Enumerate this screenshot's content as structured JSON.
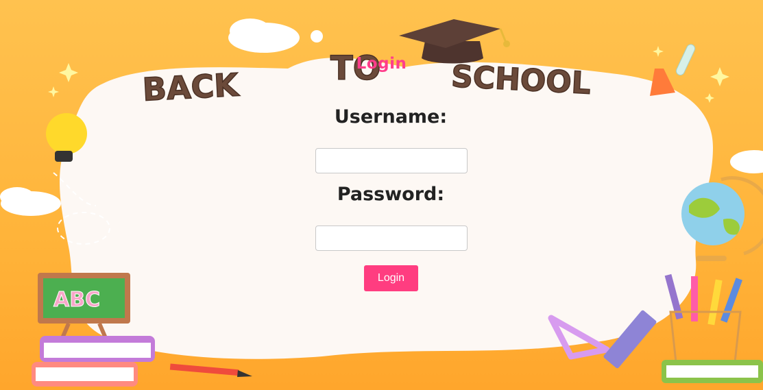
{
  "banner": {
    "word_1": "BACK",
    "word_2": "TO",
    "word_3": "SCHOOL"
  },
  "chalkboard": {
    "text": "ABC"
  },
  "form": {
    "title": "Login",
    "username_label": "Username:",
    "username_value": "",
    "password_label": "Password:",
    "password_value": "",
    "submit_label": "Login"
  },
  "colors": {
    "background": "#ffb43a",
    "accent": "#ff3d80",
    "banner_text": "#6b4a3a"
  },
  "icons": [
    "graduation-cap-icon",
    "lightbulb-icon",
    "globe-icon",
    "pencil-cup-icon",
    "chalkboard-icon",
    "books-icon",
    "ruler-icon",
    "triangle-ruler-icon",
    "pencil-icon",
    "flask-icon",
    "sparkle-icon",
    "cloud-icon"
  ]
}
